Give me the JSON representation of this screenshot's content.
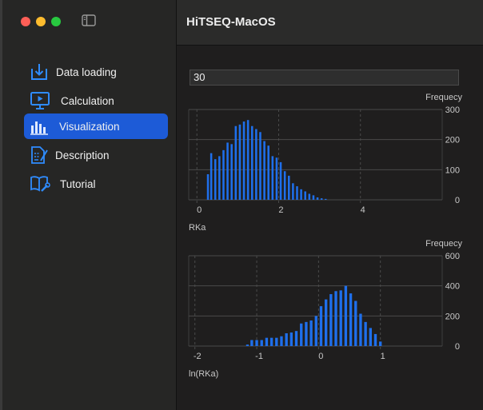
{
  "window": {
    "title": "HiTSEQ-MacOS",
    "traffic_colors": {
      "close": "#fe5f57",
      "minimize": "#febc2e",
      "zoom": "#28c840"
    }
  },
  "sidebar": {
    "items": [
      {
        "label": "Data loading",
        "icon": "download-tray-icon",
        "active": false
      },
      {
        "label": "Calculation",
        "icon": "play-monitor-icon",
        "active": false
      },
      {
        "label": "Visualization",
        "icon": "bar-chart-icon",
        "active": true
      },
      {
        "label": "Description",
        "icon": "document-pencil-icon",
        "active": false
      },
      {
        "label": "Tutorial",
        "icon": "book-wrench-icon",
        "active": false
      }
    ]
  },
  "main": {
    "bins_input": {
      "value": "30"
    }
  },
  "colors": {
    "accent": "#1d5bd7",
    "bar": "#1f6feb"
  },
  "chart_data": [
    {
      "type": "bar",
      "xlabel": "RKa",
      "ylabel": "Frequecy",
      "xlim": [
        -0.2,
        6.0
      ],
      "ylim": [
        0,
        300
      ],
      "xticks": [
        0,
        2,
        4
      ],
      "yticks": [
        0,
        100,
        200,
        300
      ],
      "grid": true,
      "x": [
        0.27,
        0.35,
        0.45,
        0.55,
        0.65,
        0.75,
        0.85,
        0.95,
        1.05,
        1.15,
        1.25,
        1.35,
        1.45,
        1.55,
        1.65,
        1.75,
        1.85,
        1.95,
        2.05,
        2.15,
        2.25,
        2.35,
        2.45,
        2.55,
        2.65,
        2.75,
        2.85,
        2.95,
        3.05,
        3.15
      ],
      "values": [
        85,
        155,
        135,
        145,
        165,
        190,
        185,
        245,
        250,
        260,
        265,
        245,
        235,
        225,
        195,
        180,
        145,
        140,
        125,
        95,
        80,
        55,
        45,
        35,
        28,
        20,
        15,
        8,
        5,
        3
      ]
    },
    {
      "type": "bar",
      "xlabel": "ln(RKa)",
      "ylabel": "Frequecy",
      "xlim": [
        -2.1,
        2.0
      ],
      "ylim": [
        0,
        600
      ],
      "xticks": [
        -2,
        -1,
        0,
        1
      ],
      "yticks": [
        0,
        200,
        400,
        600
      ],
      "grid": true,
      "x": [
        -1.15,
        -1.08,
        -1.0,
        -0.92,
        -0.84,
        -0.76,
        -0.68,
        -0.6,
        -0.52,
        -0.44,
        -0.36,
        -0.28,
        -0.2,
        -0.12,
        -0.04,
        0.04,
        0.12,
        0.2,
        0.28,
        0.36,
        0.44,
        0.52,
        0.6,
        0.68,
        0.76,
        0.84,
        0.92,
        1.0
      ],
      "values": [
        10,
        40,
        40,
        40,
        55,
        55,
        55,
        65,
        85,
        90,
        100,
        150,
        160,
        170,
        200,
        265,
        310,
        345,
        365,
        370,
        400,
        350,
        300,
        215,
        160,
        120,
        80,
        30
      ]
    }
  ]
}
